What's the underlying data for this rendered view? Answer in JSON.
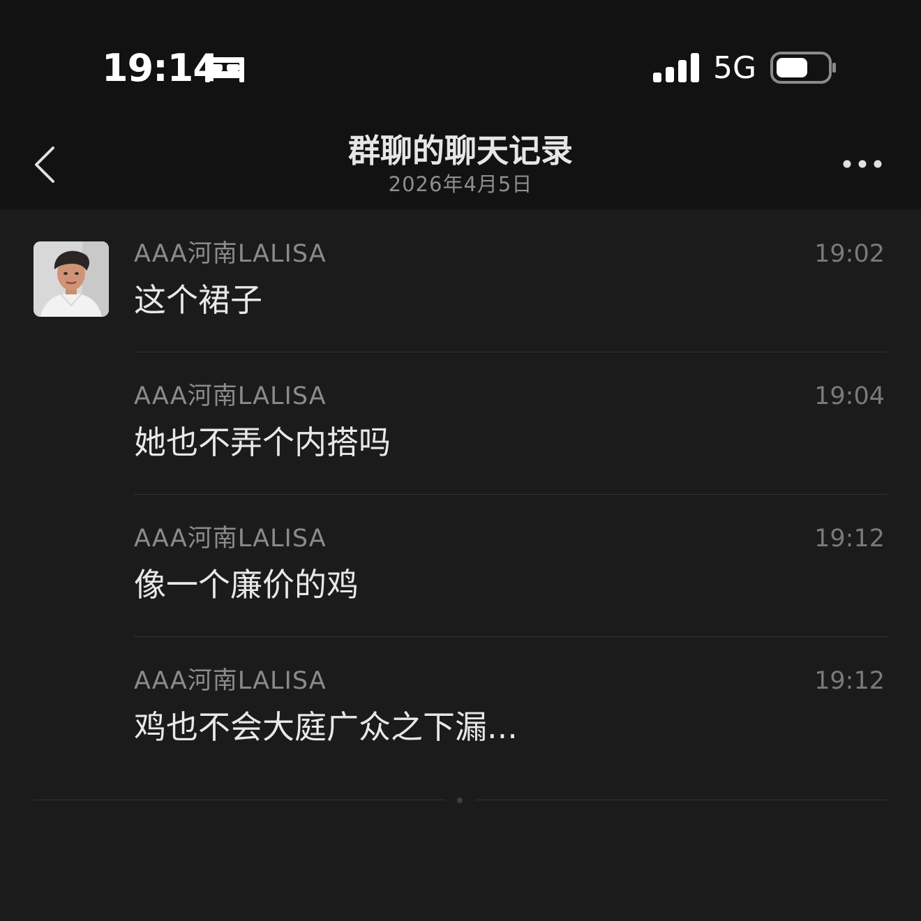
{
  "status_bar": {
    "time": "19:14",
    "network": "5G",
    "icons": [
      "bed-icon",
      "signal-icon",
      "battery-icon"
    ]
  },
  "nav": {
    "title": "群聊的聊天记录",
    "subtitle": "2026年4月5日",
    "icons": [
      "back-icon",
      "more-icon"
    ]
  },
  "messages": [
    {
      "sender": "AAA河南LALISA",
      "time": "19:02",
      "text": "这个裙子"
    },
    {
      "sender": "AAA河南LALISA",
      "time": "19:04",
      "text": "她也不弄个内搭吗"
    },
    {
      "sender": "AAA河南LALISA",
      "time": "19:12",
      "text": "像一个廉价的鸡"
    },
    {
      "sender": "AAA河南LALISA",
      "time": "19:12",
      "text": "鸡也不会大庭广众之下漏..."
    }
  ],
  "colors": {
    "background": "#1b1b1b",
    "header": "#121212",
    "text_primary": "#e8e8e8",
    "text_secondary": "#8b8b8b"
  }
}
